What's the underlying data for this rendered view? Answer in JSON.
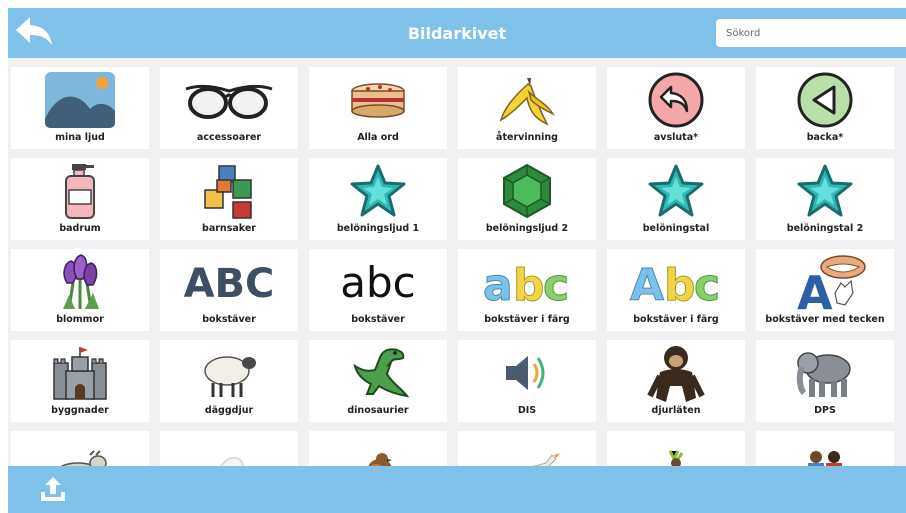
{
  "header": {
    "title": "Bildarkivet",
    "search_placeholder": "Sökord"
  },
  "tiles": [
    {
      "label": "mina ljud",
      "icon": "landscape-image-icon"
    },
    {
      "label": "accessoarer",
      "icon": "glasses-icon"
    },
    {
      "label": "Alla ord",
      "icon": "cake-icon"
    },
    {
      "label": "återvinning",
      "icon": "banana-peel-icon"
    },
    {
      "label": "avsluta*",
      "icon": "return-arrow-icon"
    },
    {
      "label": "backa*",
      "icon": "back-triangle-icon"
    },
    {
      "label": "badrum",
      "icon": "soap-bottle-icon"
    },
    {
      "label": "barnsaker",
      "icon": "toy-blocks-icon"
    },
    {
      "label": "belöningsljud 1",
      "icon": "star-icon"
    },
    {
      "label": "belöningsljud 2",
      "icon": "green-gem-icon"
    },
    {
      "label": "belöningstal",
      "icon": "star-icon"
    },
    {
      "label": "belöningstal 2",
      "icon": "star-icon"
    },
    {
      "label": "blommor",
      "icon": "crocus-flowers-icon"
    },
    {
      "label": "bokstäver",
      "icon": "abc-uppercase-icon"
    },
    {
      "label": "bokstäver",
      "icon": "abc-lowercase-icon"
    },
    {
      "label": "bokstäver i färg",
      "icon": "abc-color-lowercase-icon"
    },
    {
      "label": "bokstäver i färg",
      "icon": "abc-color-mixed-icon"
    },
    {
      "label": "bokstäver med tecken",
      "icon": "letter-a-sign-icon"
    },
    {
      "label": "byggnader",
      "icon": "castle-icon"
    },
    {
      "label": "däggdjur",
      "icon": "sheep-icon"
    },
    {
      "label": "dinosaurier",
      "icon": "dinosaur-icon"
    },
    {
      "label": "DIS",
      "icon": "speaker-icon"
    },
    {
      "label": "djurläten",
      "icon": "chimpanzee-icon"
    },
    {
      "label": "DPS",
      "icon": "elephant-icon"
    },
    {
      "label": "",
      "icon": "goat-icon"
    },
    {
      "label": "",
      "icon": "faded-animal-icon"
    },
    {
      "label": "",
      "icon": "robin-bird-icon"
    },
    {
      "label": "",
      "icon": "white-bird-icon"
    },
    {
      "label": "",
      "icon": "dancer-icon"
    },
    {
      "label": "",
      "icon": "people-icon"
    }
  ]
}
